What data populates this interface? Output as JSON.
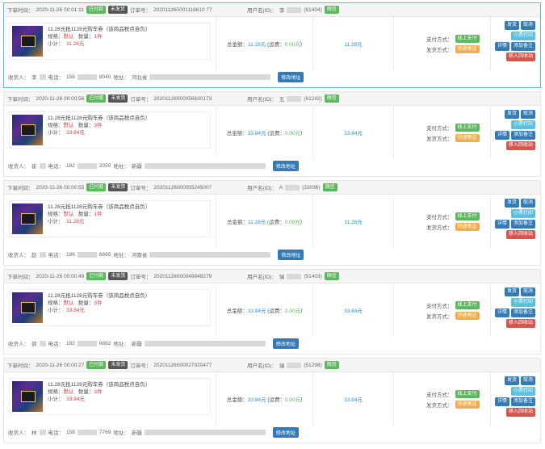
{
  "labels": {
    "order_time": "下单时间：",
    "order_no": "订单号：",
    "user": "用户名(ID)：",
    "spec": "规格：",
    "spec_value": "默认",
    "qty": "数量：",
    "subtotal": "小计：",
    "total": "总金额：",
    "freight": "(运费：",
    "pay_method": "支付方式：",
    "ship_method": "发货方式：",
    "consignee": "收货人：",
    "phone": "电话：",
    "address": "地址：",
    "paren_close": ")"
  },
  "tags": {
    "paid": "已付款",
    "unsent": "未发货",
    "wx": "微信",
    "online": "线上支付",
    "express": "快递寄送"
  },
  "buttons": {
    "ship": "发货",
    "cancel": "取消",
    "print": "小票打印",
    "detail": "详情",
    "note": "添加备注",
    "recycle": "移入回收站",
    "edit_address": "修改地址"
  },
  "orders": [
    {
      "time": "2020-11-26 00:01:11",
      "order_no": "202011260001116610 77",
      "user_name": "李",
      "user_id": "(61404)",
      "product": "11.28元抵1128元购车券（该商品税点自负）",
      "qty": "1件",
      "subtotal": "11.28元",
      "total": "11.28元",
      "freight": "0.00元",
      "price": "11.28元",
      "name": "李",
      "phone_a": "156",
      "phone_b": "8040",
      "addr": "河北省"
    },
    {
      "time": "2020-11-26 00:00:56",
      "order_no": "20201126000056630173",
      "user_name": "五",
      "user_id": "(61242)",
      "product": "11.28元抵1128元购车券（该商品税点自负）",
      "qty": "3件",
      "subtotal": "33.84元",
      "total": "33.84元",
      "freight": "0.00元",
      "price": "33.84元",
      "name": "崔",
      "phone_a": "182",
      "phone_b": "2050",
      "addr": "新疆"
    },
    {
      "time": "2020-11-26 00:00:55",
      "order_no": "20201126000055245007",
      "user_name": "A",
      "user_id": "(33036)",
      "product": "11.28元抵1128元购车券（该商品税点自负）",
      "qty": "1件",
      "subtotal": "11.28元",
      "total": "11.28元",
      "freight": "0.00元",
      "price": "11.28元",
      "name": "赵",
      "phone_a": "186",
      "phone_b": "6665",
      "addr": "河南省"
    },
    {
      "time": "2020-11-26 00:00:49",
      "order_no": "20201126000049948279",
      "user_name": "瑞",
      "user_id": "(51403)",
      "product": "11.28元抵1128元购车券（该商品税点自负）",
      "qty": "3件",
      "subtotal": "33.84元",
      "total": "33.84元",
      "freight": "0.00元",
      "price": "33.84元",
      "name": "郭",
      "phone_a": "182",
      "phone_b": "8862",
      "addr": "新疆"
    },
    {
      "time": "2020-11-26 00:00:27",
      "order_no": "20201126000027920477",
      "user_name": "瑞",
      "user_id": "(51298)",
      "product": "11.28元抵1128元购车券（该商品税点自负）",
      "qty": "3件",
      "subtotal": "33.84元",
      "total": "33.84元",
      "freight": "0.00元",
      "price": "33.84元",
      "name": "林",
      "phone_a": "158",
      "phone_b": "7769",
      "addr": "新疆"
    }
  ]
}
